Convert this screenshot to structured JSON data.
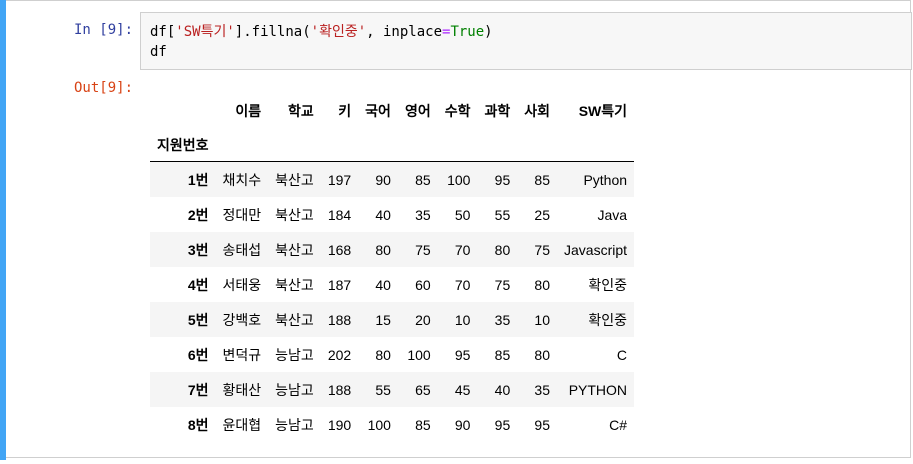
{
  "input": {
    "prompt": "In [9]:",
    "code_line1": {
      "p1": "df[",
      "p2": "'SW특기'",
      "p3": "].fillna(",
      "p4": "'확인중'",
      "p5": ", inplace",
      "p6": "=",
      "p7": "True",
      "p8": ")"
    },
    "code_line2": "df"
  },
  "output": {
    "prompt": "Out[9]:",
    "table": {
      "columns": [
        "이름",
        "학교",
        "키",
        "국어",
        "영어",
        "수학",
        "과학",
        "사회",
        "SW특기"
      ],
      "index_name": "지원번호",
      "rows": [
        {
          "index": "1번",
          "cells": [
            "채치수",
            "북산고",
            "197",
            "90",
            "85",
            "100",
            "95",
            "85",
            "Python"
          ]
        },
        {
          "index": "2번",
          "cells": [
            "정대만",
            "북산고",
            "184",
            "40",
            "35",
            "50",
            "55",
            "25",
            "Java"
          ]
        },
        {
          "index": "3번",
          "cells": [
            "송태섭",
            "북산고",
            "168",
            "80",
            "75",
            "70",
            "80",
            "75",
            "Javascript"
          ]
        },
        {
          "index": "4번",
          "cells": [
            "서태웅",
            "북산고",
            "187",
            "40",
            "60",
            "70",
            "75",
            "80",
            "확인중"
          ]
        },
        {
          "index": "5번",
          "cells": [
            "강백호",
            "북산고",
            "188",
            "15",
            "20",
            "10",
            "35",
            "10",
            "확인중"
          ]
        },
        {
          "index": "6번",
          "cells": [
            "변덕규",
            "능남고",
            "202",
            "80",
            "100",
            "95",
            "85",
            "80",
            "C"
          ]
        },
        {
          "index": "7번",
          "cells": [
            "황태산",
            "능남고",
            "188",
            "55",
            "65",
            "45",
            "40",
            "35",
            "PYTHON"
          ]
        },
        {
          "index": "8번",
          "cells": [
            "윤대협",
            "능남고",
            "190",
            "100",
            "85",
            "90",
            "95",
            "95",
            "C#"
          ]
        }
      ]
    }
  }
}
